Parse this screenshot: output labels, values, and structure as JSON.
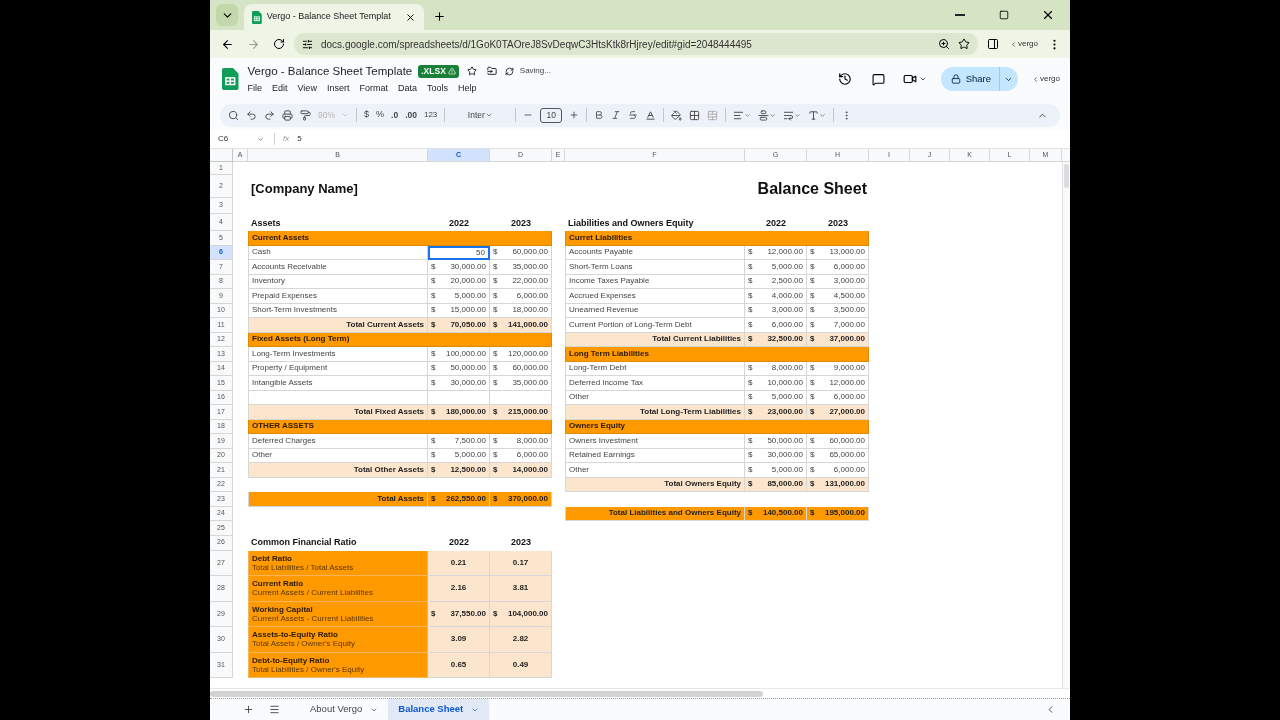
{
  "browser": {
    "tab_title": "Vergo - Balance Sheet Templat",
    "url": "docs.google.com/spreadsheets/d/1GoK0TAOreJ8SvDeqwC3HtsKtk8rHjrey/edit#gid=2048444495",
    "extension_label": "vergo"
  },
  "doc": {
    "title": "Vergo - Balance Sheet Template",
    "badge": ".XLSX",
    "status": "Saving...",
    "menu": [
      "File",
      "Edit",
      "View",
      "Insert",
      "Format",
      "Data",
      "Tools",
      "Help"
    ],
    "share": "Share",
    "brand_label": "vergo"
  },
  "toolbar": {
    "zoom": {
      "label": "90%",
      "disabled": true
    },
    "currency": "$",
    "percent": "%",
    "decrease_decimal": ".0",
    "increase_decimal": ".00",
    "number_format": "123",
    "font": "Inter",
    "font_size": "10"
  },
  "formula_bar": {
    "cell_ref": "C6",
    "fx": "fx",
    "value": "5"
  },
  "column_headers": [
    {
      "label": "A",
      "selected": false
    },
    {
      "label": "B",
      "selected": false
    },
    {
      "label": "C",
      "selected": true
    },
    {
      "label": "D",
      "selected": false
    },
    {
      "label": "E",
      "selected": false
    },
    {
      "label": "F",
      "selected": false
    },
    {
      "label": "G",
      "selected": false
    },
    {
      "label": "H",
      "selected": false
    },
    {
      "label": "I",
      "selected": false
    },
    {
      "label": "J",
      "selected": false
    },
    {
      "label": "K",
      "selected": false
    },
    {
      "label": "L",
      "selected": false
    },
    {
      "label": "M",
      "selected": false
    }
  ],
  "row_headers": [
    {
      "label": "1",
      "selected": false
    },
    {
      "label": "2",
      "selected": false
    },
    {
      "label": "3",
      "selected": false
    },
    {
      "label": "4",
      "selected": false
    },
    {
      "label": "5",
      "selected": false
    },
    {
      "label": "6",
      "selected": true
    },
    {
      "label": "7",
      "selected": false
    },
    {
      "label": "8",
      "selected": false
    },
    {
      "label": "9",
      "selected": false
    },
    {
      "label": "10",
      "selected": false
    },
    {
      "label": "11",
      "selected": false
    },
    {
      "label": "12",
      "selected": false
    },
    {
      "label": "13",
      "selected": false
    },
    {
      "label": "14",
      "selected": false
    },
    {
      "label": "15",
      "selected": false
    },
    {
      "label": "16",
      "selected": false
    },
    {
      "label": "17",
      "selected": false
    },
    {
      "label": "18",
      "selected": false
    },
    {
      "label": "19",
      "selected": false
    },
    {
      "label": "20",
      "selected": false
    },
    {
      "label": "21",
      "selected": false
    },
    {
      "label": "22",
      "selected": false
    },
    {
      "label": "23",
      "selected": false
    },
    {
      "label": "24",
      "selected": false
    },
    {
      "label": "25",
      "selected": false
    },
    {
      "label": "26",
      "selected": false
    },
    {
      "label": "27",
      "selected": false
    },
    {
      "label": "28",
      "selected": false
    },
    {
      "label": "29",
      "selected": false
    },
    {
      "label": "30",
      "selected": false
    },
    {
      "label": "31",
      "selected": false
    }
  ],
  "company_name": "[Company Name]",
  "sheet_title": "Balance Sheet",
  "assets": {
    "heading": "Assets",
    "years": [
      "2022",
      "2023"
    ],
    "groups": [
      {
        "title": "Current Assets",
        "rows": [
          {
            "kind": "item",
            "label": "Cash",
            "cells": [
              {
                "value": "50",
                "editing": true
              },
              {
                "currency": "$",
                "value": "60,000.00",
                "editing": false
              }
            ]
          },
          {
            "kind": "item",
            "label": "Accounts Receivable",
            "cells": [
              {
                "currency": "$",
                "value": "30,000.00",
                "editing": false
              },
              {
                "currency": "$",
                "value": "35,000.00",
                "editing": false
              }
            ]
          },
          {
            "kind": "item",
            "label": "Inventory",
            "cells": [
              {
                "currency": "$",
                "value": "20,000.00",
                "editing": false
              },
              {
                "currency": "$",
                "value": "22,000.00",
                "editing": false
              }
            ]
          },
          {
            "kind": "item",
            "label": "Prepaid Expenses",
            "cells": [
              {
                "currency": "$",
                "value": "5,000.00",
                "editing": false
              },
              {
                "currency": "$",
                "value": "6,000.00",
                "editing": false
              }
            ]
          },
          {
            "kind": "item",
            "label": "Short-Term Investments",
            "cells": [
              {
                "currency": "$",
                "value": "15,000.00",
                "editing": false
              },
              {
                "currency": "$",
                "value": "18,000.00",
                "editing": false
              }
            ]
          }
        ],
        "total": {
          "label": "Total Current Assets",
          "cells": [
            {
              "currency": "$",
              "value": "70,050.00",
              "editing": false
            },
            {
              "currency": "$",
              "value": "141,000.00",
              "editing": false
            }
          ]
        }
      },
      {
        "title": "Fixed Assets (Long Term)",
        "rows": [
          {
            "kind": "item",
            "label": "Long-Term Investments",
            "cells": [
              {
                "currency": "$",
                "value": "100,000.00",
                "editing": false
              },
              {
                "currency": "$",
                "value": "120,000.00",
                "editing": false
              }
            ]
          },
          {
            "kind": "item",
            "label": "Property / Equipment",
            "cells": [
              {
                "currency": "$",
                "value": "50,000.00",
                "editing": false
              },
              {
                "currency": "$",
                "value": "60,000.00",
                "editing": false
              }
            ]
          },
          {
            "kind": "item",
            "label": "Intangible Assets",
            "cells": [
              {
                "currency": "$",
                "value": "30,000.00",
                "editing": false
              },
              {
                "currency": "$",
                "value": "35,000.00",
                "editing": false
              }
            ]
          },
          {
            "kind": "blank"
          }
        ],
        "total": {
          "label": "Total Fixed Assets",
          "cells": [
            {
              "currency": "$",
              "value": "180,000.00",
              "editing": false
            },
            {
              "currency": "$",
              "value": "215,000.00",
              "editing": false
            }
          ]
        }
      },
      {
        "title": "OTHER ASSETS",
        "rows": [
          {
            "kind": "item",
            "label": "Deferred Charges",
            "cells": [
              {
                "currency": "$",
                "value": "7,500.00",
                "editing": false
              },
              {
                "currency": "$",
                "value": "8,000.00",
                "editing": false
              }
            ]
          },
          {
            "kind": "item",
            "label": "Other",
            "cells": [
              {
                "currency": "$",
                "value": "5,000.00",
                "editing": false
              },
              {
                "currency": "$",
                "value": "6,000.00",
                "editing": false
              }
            ]
          }
        ],
        "total": {
          "label": "Total Other Assets",
          "cells": [
            {
              "currency": "$",
              "value": "12,500.00",
              "editing": false
            },
            {
              "currency": "$",
              "value": "14,000.00",
              "editing": false
            }
          ]
        }
      }
    ],
    "grand_total": {
      "label": "Total Assets",
      "cells": [
        {
          "currency": "$",
          "value": "262,550.00",
          "editing": false
        },
        {
          "currency": "$",
          "value": "370,000.00",
          "editing": false
        }
      ]
    }
  },
  "liabilities": {
    "heading": "Liabilities and Owners Equity",
    "years": [
      "2022",
      "2023"
    ],
    "groups": [
      {
        "title": "Curret Liabilities",
        "rows": [
          {
            "kind": "item",
            "label": "Accounts Payable",
            "cells": [
              {
                "currency": "$",
                "value": "12,000.00",
                "editing": false
              },
              {
                "currency": "$",
                "value": "13,000.00",
                "editing": false
              }
            ]
          },
          {
            "kind": "item",
            "label": "Short-Term Loans",
            "cells": [
              {
                "currency": "$",
                "value": "5,000.00",
                "editing": false
              },
              {
                "currency": "$",
                "value": "6,000.00",
                "editing": false
              }
            ]
          },
          {
            "kind": "item",
            "label": "Income Taxes Payable",
            "cells": [
              {
                "currency": "$",
                "value": "2,500.00",
                "editing": false
              },
              {
                "currency": "$",
                "value": "3,000.00",
                "editing": false
              }
            ]
          },
          {
            "kind": "item",
            "label": "Accrued Expenses",
            "cells": [
              {
                "currency": "$",
                "value": "4,000.00",
                "editing": false
              },
              {
                "currency": "$",
                "value": "4,500.00",
                "editing": false
              }
            ]
          },
          {
            "kind": "item",
            "label": "Unearned Revenue",
            "cells": [
              {
                "currency": "$",
                "value": "3,000.00",
                "editing": false
              },
              {
                "currency": "$",
                "value": "3,500.00",
                "editing": false
              }
            ]
          },
          {
            "kind": "item",
            "label": "Current Portion of Long-Term Debt",
            "cells": [
              {
                "currency": "$",
                "value": "6,000.00",
                "editing": false
              },
              {
                "currency": "$",
                "value": "7,000.00",
                "editing": false
              }
            ]
          }
        ],
        "total": {
          "label": "Total Current Liabilities",
          "cells": [
            {
              "currency": "$",
              "value": "32,500.00",
              "editing": false
            },
            {
              "currency": "$",
              "value": "37,000.00",
              "editing": false
            }
          ]
        }
      },
      {
        "title": "Long Term Liabilities",
        "rows": [
          {
            "kind": "item",
            "label": "Long-Term Debt",
            "cells": [
              {
                "currency": "$",
                "value": "8,000.00",
                "editing": false
              },
              {
                "currency": "$",
                "value": "9,000.00",
                "editing": false
              }
            ]
          },
          {
            "kind": "item",
            "label": "Deferred Income Tax",
            "cells": [
              {
                "currency": "$",
                "value": "10,000.00",
                "editing": false
              },
              {
                "currency": "$",
                "value": "12,000.00",
                "editing": false
              }
            ]
          },
          {
            "kind": "item",
            "label": "Other",
            "cells": [
              {
                "currency": "$",
                "value": "5,000.00",
                "editing": false
              },
              {
                "currency": "$",
                "value": "6,000.00",
                "editing": false
              }
            ]
          }
        ],
        "total": {
          "label": "Total Long-Term Liabilities",
          "cells": [
            {
              "currency": "$",
              "value": "23,000.00",
              "editing": false
            },
            {
              "currency": "$",
              "value": "27,000.00",
              "editing": false
            }
          ]
        }
      },
      {
        "title": "Owners Equity",
        "rows": [
          {
            "kind": "item",
            "label": "Owners Investment",
            "cells": [
              {
                "currency": "$",
                "value": "50,000.00",
                "editing": false
              },
              {
                "currency": "$",
                "value": "60,000.00",
                "editing": false
              }
            ]
          },
          {
            "kind": "item",
            "label": "Retained Earnings",
            "cells": [
              {
                "currency": "$",
                "value": "30,000.00",
                "editing": false
              },
              {
                "currency": "$",
                "value": "65,000.00",
                "editing": false
              }
            ]
          },
          {
            "kind": "item",
            "label": "Other",
            "cells": [
              {
                "currency": "$",
                "value": "5,000.00",
                "editing": false
              },
              {
                "currency": "$",
                "value": "6,000.00",
                "editing": false
              }
            ]
          }
        ],
        "total": {
          "label": "Total Owners Equity",
          "cells": [
            {
              "currency": "$",
              "value": "85,000.00",
              "editing": false
            },
            {
              "currency": "$",
              "value": "131,000.00",
              "editing": false
            }
          ]
        }
      }
    ],
    "grand_total": {
      "label": "Total Liabilities and Owners Equity",
      "cells": [
        {
          "currency": "$",
          "value": "140,500.00",
          "editing": false
        },
        {
          "currency": "$",
          "value": "195,000.00",
          "editing": false
        }
      ]
    }
  },
  "ratios": {
    "heading": "Common Financial Ratio",
    "years": [
      "2022",
      "2023"
    ],
    "rows": [
      {
        "name": "Debt Ratio",
        "formula": "Total Liabilities / Total Assets",
        "cells": [
          {
            "value": "0.21",
            "editing": false
          },
          {
            "value": "0.17",
            "editing": false
          }
        ]
      },
      {
        "name": "Current Ratio",
        "formula": "Current Assets / Current Liabilities",
        "cells": [
          {
            "value": "2.16",
            "editing": false
          },
          {
            "value": "3.81",
            "editing": false
          }
        ]
      },
      {
        "name": "Working Capital",
        "formula": "Current Assets - Current Liabilities",
        "cells": [
          {
            "currency": "$",
            "value": "37,550.00",
            "editing": false
          },
          {
            "currency": "$",
            "value": "104,000.00",
            "editing": false
          }
        ]
      },
      {
        "name": "Assets-to-Equity Ratio",
        "formula": "Total Assets / Owner's Equity",
        "cells": [
          {
            "value": "3.09",
            "editing": false
          },
          {
            "value": "2.82",
            "editing": false
          }
        ]
      },
      {
        "name": "Debt-to-Equity Ratio",
        "formula": "Total Liabilities / Owner's Equity",
        "cells": [
          {
            "value": "0.65",
            "editing": false
          },
          {
            "value": "0.49",
            "editing": false
          }
        ]
      }
    ]
  },
  "sheet_tabs": [
    {
      "label": "About Vergo",
      "selected": false
    },
    {
      "label": "Balance Sheet",
      "selected": true
    }
  ]
}
